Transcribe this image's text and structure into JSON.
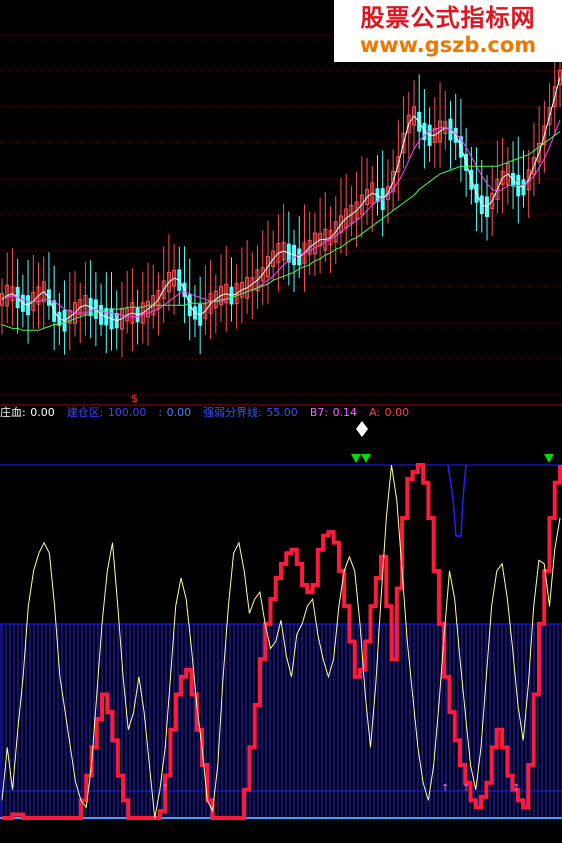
{
  "watermark": {
    "title": "股票公式指标网",
    "url": "www.gszb.com"
  },
  "colors": {
    "up": "#ff5050",
    "down": "#54ffff",
    "ma5": "#ffffff",
    "ma10": "#ff40ff",
    "ma30": "#40ff40",
    "grid": "#8b0000",
    "blue": "#2020ff",
    "yellow": "#ffff99",
    "red": "#ff1a3c",
    "green": "#00dd00"
  },
  "marker": "$",
  "legend": [
    {
      "label": "庄血",
      "sep": ": ",
      "value": "0.00",
      "label_color": "#ffffff",
      "value_color": "#ffffff"
    },
    {
      "label": "建仓区",
      "sep": ": ",
      "value": "100.00",
      "label_color": "#4040ff",
      "value_color": "#4040ff"
    },
    {
      "label": "",
      "sep": ": ",
      "value": "0.00",
      "label_color": "#4080ff",
      "value_color": "#4080ff"
    },
    {
      "label": "强弱分界线",
      "sep": ": ",
      "value": "55.00",
      "label_color": "#3050ff",
      "value_color": "#3050ff"
    },
    {
      "label": "B7",
      "sep": ": ",
      "value": "0.14",
      "label_color": "#ff60ff",
      "value_color": "#ff60ff"
    },
    {
      "label": "A",
      "sep": ": ",
      "value": "0.00",
      "label_color": "#ff4040",
      "value_color": "#ff4040"
    }
  ],
  "chart_data": [
    {
      "type": "candlestick",
      "series": [
        {
          "name": "ma5",
          "values": [
            2.1,
            2.3,
            2.4,
            2.2,
            1.9,
            1.8,
            2.0,
            2.3,
            2.5,
            2.2,
            1.5,
            1.1,
            1.0,
            1.2,
            1.4,
            1.7,
            1.8,
            1.7,
            1.6,
            1.3,
            1.2,
            1.1,
            1.0,
            1.1,
            1.3,
            1.4,
            1.3,
            1.4,
            1.6,
            1.8,
            2.1,
            2.6,
            3.0,
            3.2,
            3.1,
            2.6,
            1.8,
            1.4,
            1.3,
            1.5,
            1.9,
            2.1,
            2.3,
            2.4,
            2.3,
            2.4,
            2.6,
            2.7,
            2.9,
            3.1,
            3.4,
            3.8,
            4.2,
            4.5,
            4.6,
            4.5,
            4.4,
            4.3,
            4.5,
            4.8,
            5.0,
            5.2,
            5.2,
            5.3,
            5.6,
            6.0,
            6.3,
            6.5,
            6.7,
            7.0,
            7.4,
            7.6,
            7.5,
            7.3,
            7.6,
            8.2,
            9.1,
            10.2,
            11.2,
            11.6,
            11.3,
            10.8,
            10.6,
            10.6,
            10.8,
            11.0,
            10.9,
            10.6,
            10.0,
            9.2,
            8.3,
            7.6,
            7.0,
            6.9,
            7.2,
            7.8,
            8.4,
            8.6,
            8.3,
            8.0,
            7.9,
            8.3,
            9.0,
            9.7,
            10.6,
            11.6,
            12.6,
            13.6
          ]
        },
        {
          "name": "ma10",
          "values": [
            2.2,
            2.2,
            2.3,
            2.2,
            2.1,
            2.0,
            2.0,
            2.0,
            2.1,
            2.1,
            2.0,
            1.8,
            1.6,
            1.5,
            1.4,
            1.4,
            1.4,
            1.5,
            1.6,
            1.5,
            1.4,
            1.4,
            1.3,
            1.3,
            1.2,
            1.2,
            1.2,
            1.3,
            1.4,
            1.5,
            1.6,
            1.8,
            2.0,
            2.2,
            2.4,
            2.5,
            2.4,
            2.3,
            2.2,
            2.1,
            2.0,
            2.0,
            2.0,
            2.1,
            2.2,
            2.3,
            2.4,
            2.5,
            2.6,
            2.7,
            2.9,
            3.1,
            3.3,
            3.6,
            3.9,
            4.1,
            4.3,
            4.4,
            4.5,
            4.6,
            4.8,
            4.9,
            5.1,
            5.2,
            5.4,
            5.6,
            5.8,
            6.0,
            6.2,
            6.4,
            6.7,
            7.0,
            7.2,
            7.3,
            7.5,
            7.8,
            8.2,
            8.7,
            9.3,
            9.9,
            10.3,
            10.6,
            10.8,
            10.9,
            11.0,
            11.0,
            10.9,
            10.7,
            10.4,
            10.0,
            9.5,
            9.0,
            8.5,
            8.1,
            7.8,
            7.7,
            7.8,
            8.0,
            8.0,
            8.0,
            8.0,
            8.2,
            8.5,
            8.9,
            9.4,
            10.0,
            10.7,
            11.4
          ]
        },
        {
          "name": "ma30",
          "values": [
            0.8,
            0.7,
            0.6,
            0.6,
            0.5,
            0.5,
            0.5,
            0.5,
            0.6,
            0.7,
            0.8,
            0.8,
            0.9,
            1.0,
            1.1,
            1.2,
            1.3,
            1.3,
            1.4,
            1.5,
            1.5,
            1.6,
            1.6,
            1.6,
            1.7,
            1.7,
            1.7,
            1.7,
            1.8,
            1.8,
            1.8,
            1.8,
            1.8,
            1.8,
            1.8,
            1.8,
            1.9,
            1.9,
            1.9,
            1.9,
            2.0,
            2.0,
            2.1,
            2.1,
            2.2,
            2.3,
            2.4,
            2.5,
            2.6,
            2.7,
            2.8,
            2.9,
            3.1,
            3.2,
            3.3,
            3.4,
            3.5,
            3.7,
            3.8,
            3.9,
            4.1,
            4.2,
            4.4,
            4.5,
            4.7,
            4.8,
            5.0,
            5.2,
            5.3,
            5.5,
            5.7,
            5.9,
            6.1,
            6.3,
            6.5,
            6.7,
            6.9,
            7.1,
            7.3,
            7.5,
            7.8,
            8.0,
            8.2,
            8.4,
            8.6,
            8.7,
            8.8,
            8.9,
            9.0,
            9.0,
            9.0,
            9.0,
            9.0,
            9.0,
            9.0,
            9.0,
            9.1,
            9.2,
            9.3,
            9.4,
            9.5,
            9.6,
            9.8,
            10.0,
            10.2,
            10.4,
            10.6,
            10.8
          ]
        }
      ]
    },
    {
      "type": "line",
      "series": [
        {
          "name": "庄血",
          "values": [
            5,
            20,
            8,
            25,
            40,
            60,
            70,
            75,
            78,
            75,
            60,
            40,
            30,
            20,
            10,
            5,
            3,
            15,
            35,
            55,
            70,
            78,
            60,
            40,
            25,
            30,
            40,
            30,
            15,
            0,
            8,
            20,
            40,
            60,
            68,
            62,
            48,
            32,
            20,
            5,
            2,
            15,
            40,
            60,
            75,
            78,
            70,
            58,
            62,
            64,
            55,
            48,
            50,
            56,
            46,
            40,
            52,
            55,
            60,
            62,
            52,
            45,
            40,
            45,
            60,
            70,
            74,
            70,
            55,
            35,
            20,
            38,
            62,
            85,
            100,
            90,
            70,
            50,
            35,
            20,
            10,
            5,
            15,
            32,
            52,
            70,
            62,
            45,
            30,
            15,
            8,
            20,
            40,
            60,
            70,
            72,
            62,
            48,
            32,
            22,
            38,
            60,
            73,
            72,
            60,
            76,
            85
          ]
        },
        {
          "name": "A",
          "values": [
            0,
            0,
            1,
            1,
            0,
            0,
            0,
            0,
            0,
            0,
            0,
            0,
            0,
            0,
            0,
            5,
            12,
            20,
            28,
            35,
            30,
            22,
            12,
            5,
            0,
            0,
            0,
            0,
            0,
            0,
            2,
            12,
            25,
            35,
            40,
            42,
            35,
            25,
            15,
            5,
            0,
            0,
            0,
            0,
            0,
            0,
            8,
            20,
            32,
            45,
            55,
            62,
            68,
            72,
            75,
            76,
            72,
            66,
            64,
            66,
            76,
            80,
            81,
            78,
            70,
            60,
            50,
            40,
            42,
            50,
            60,
            68,
            74,
            60,
            45,
            65,
            85,
            96,
            98,
            100,
            95,
            85,
            70,
            55,
            40,
            30,
            22,
            15,
            10,
            5,
            3,
            6,
            10,
            20,
            25,
            20,
            12,
            8,
            5,
            3,
            15,
            35,
            55,
            70,
            85,
            95,
            100
          ]
        }
      ]
    }
  ]
}
